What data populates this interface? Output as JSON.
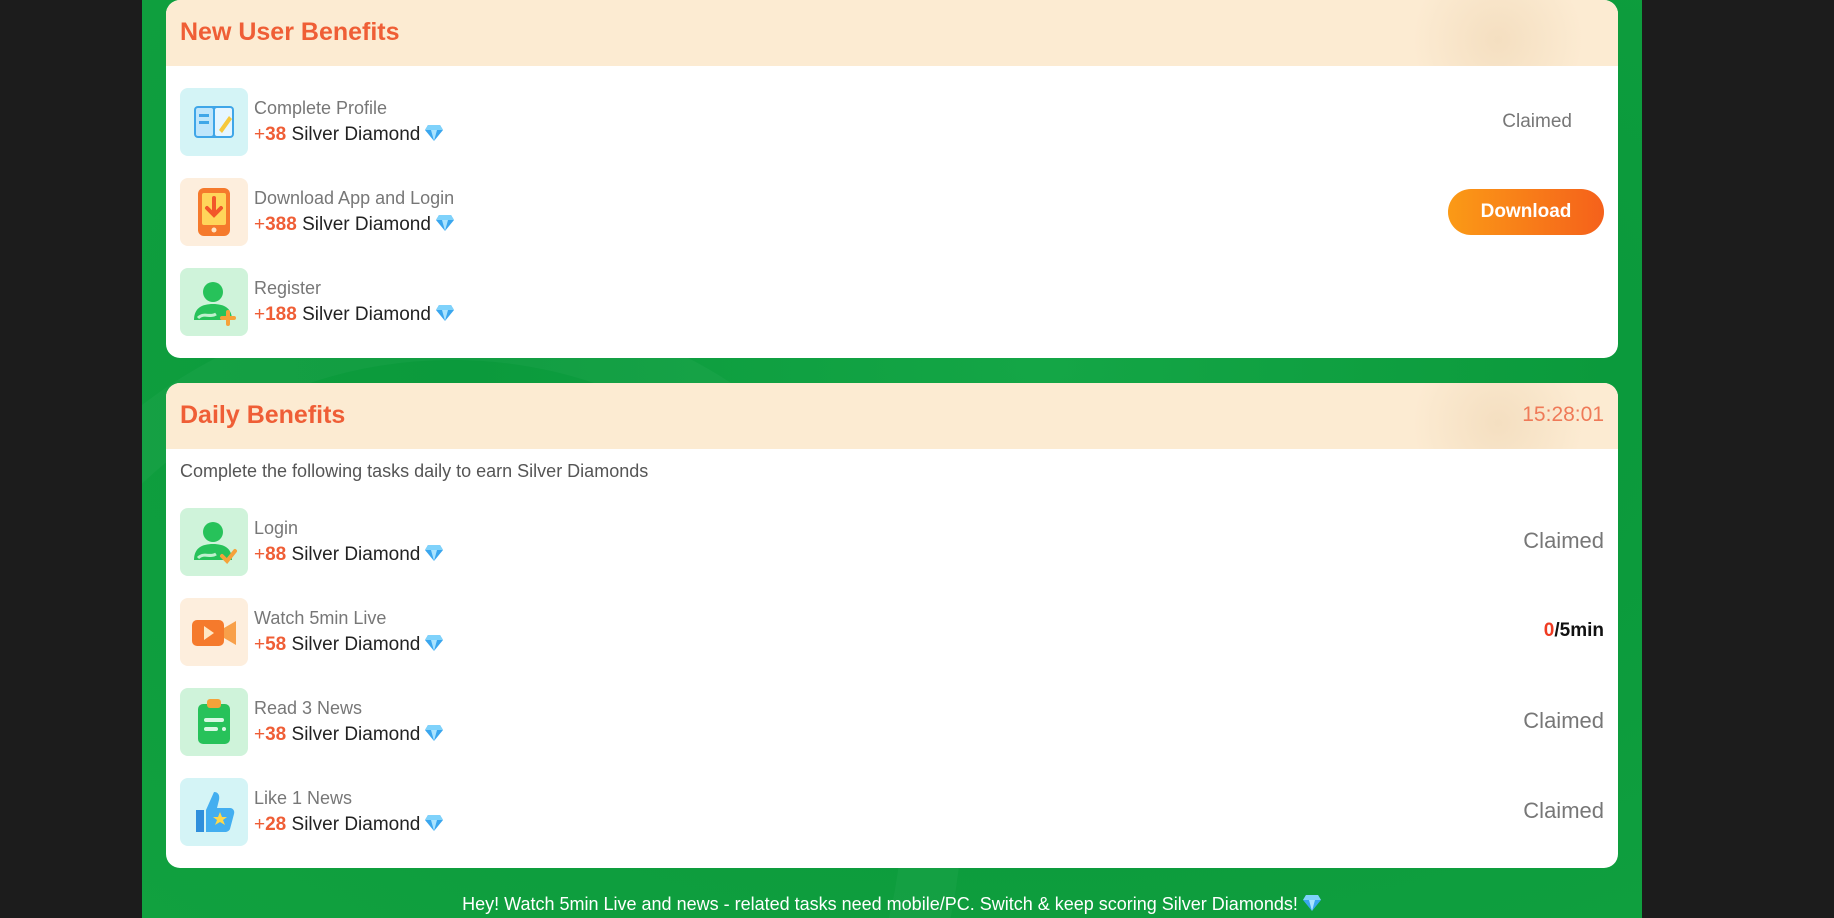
{
  "new_user": {
    "title": "New User Benefits",
    "tasks": [
      {
        "name": "Complete Profile",
        "plus": "+",
        "amount": "38",
        "unit": "Silver Diamond",
        "icon": "profile-book-icon",
        "status": "Claimed"
      },
      {
        "name": "Download App and Login",
        "plus": "+",
        "amount": "388",
        "unit": "Silver Diamond",
        "icon": "phone-download-icon",
        "button": "Download"
      },
      {
        "name": "Register",
        "plus": "+",
        "amount": "188",
        "unit": "Silver Diamond",
        "icon": "user-add-icon"
      }
    ]
  },
  "daily": {
    "title": "Daily Benefits",
    "timer": "15:28:01",
    "subtitle": "Complete the following tasks daily to earn Silver Diamonds",
    "tasks": [
      {
        "name": "Login",
        "plus": "+",
        "amount": "88",
        "unit": "Silver Diamond",
        "icon": "user-check-icon",
        "status": "Claimed"
      },
      {
        "name": "Watch 5min Live",
        "plus": "+",
        "amount": "58",
        "unit": "Silver Diamond",
        "icon": "video-camera-icon",
        "progress_current": "0",
        "progress_total": "/5min"
      },
      {
        "name": "Read 3 News",
        "plus": "+",
        "amount": "38",
        "unit": "Silver Diamond",
        "icon": "clipboard-news-icon",
        "status": "Claimed"
      },
      {
        "name": "Like 1 News",
        "plus": "+",
        "amount": "28",
        "unit": "Silver Diamond",
        "icon": "thumbs-up-star-icon",
        "status": "Claimed"
      }
    ]
  },
  "footer": {
    "note": "Hey! Watch 5min Live and news - related tasks need mobile/PC. Switch & keep scoring Silver Diamonds!"
  },
  "colors": {
    "accent": "#ef5e36",
    "header_bg": "#fcebd2",
    "page_green": "#11a13f",
    "button_start": "#fb9a16",
    "button_end": "#f5611b"
  }
}
